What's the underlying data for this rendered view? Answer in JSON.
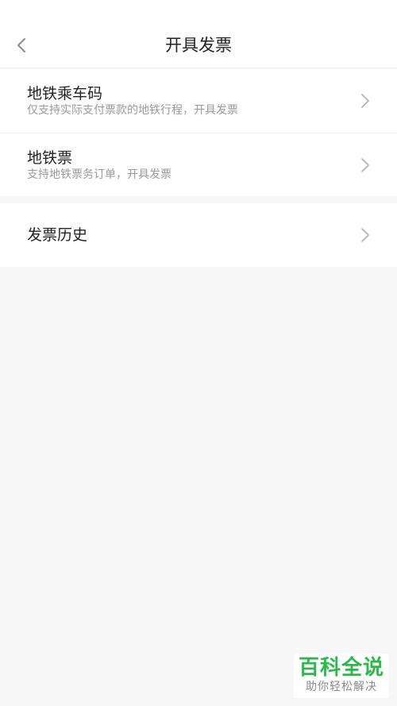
{
  "header": {
    "title": "开具发票",
    "back_icon": "chevron-left-icon"
  },
  "invoice_options": [
    {
      "title": "地铁乘车码",
      "subtitle": "仅支持实际支付票款的地铁行程，开具发票",
      "icon": "chevron-right-icon"
    },
    {
      "title": "地铁票",
      "subtitle": "支持地铁票务订单，开具发票",
      "icon": "chevron-right-icon"
    }
  ],
  "history": {
    "title": "发票历史",
    "icon": "chevron-right-icon"
  },
  "watermark": {
    "main": "百科全说",
    "sub": "助你轻松解决"
  },
  "colors": {
    "background": "#f7f7f7",
    "card": "#ffffff",
    "text_primary": "#222222",
    "text_secondary": "#9a9a9a",
    "chevron": "#b3b3b3",
    "watermark_green": "#2db84d"
  }
}
